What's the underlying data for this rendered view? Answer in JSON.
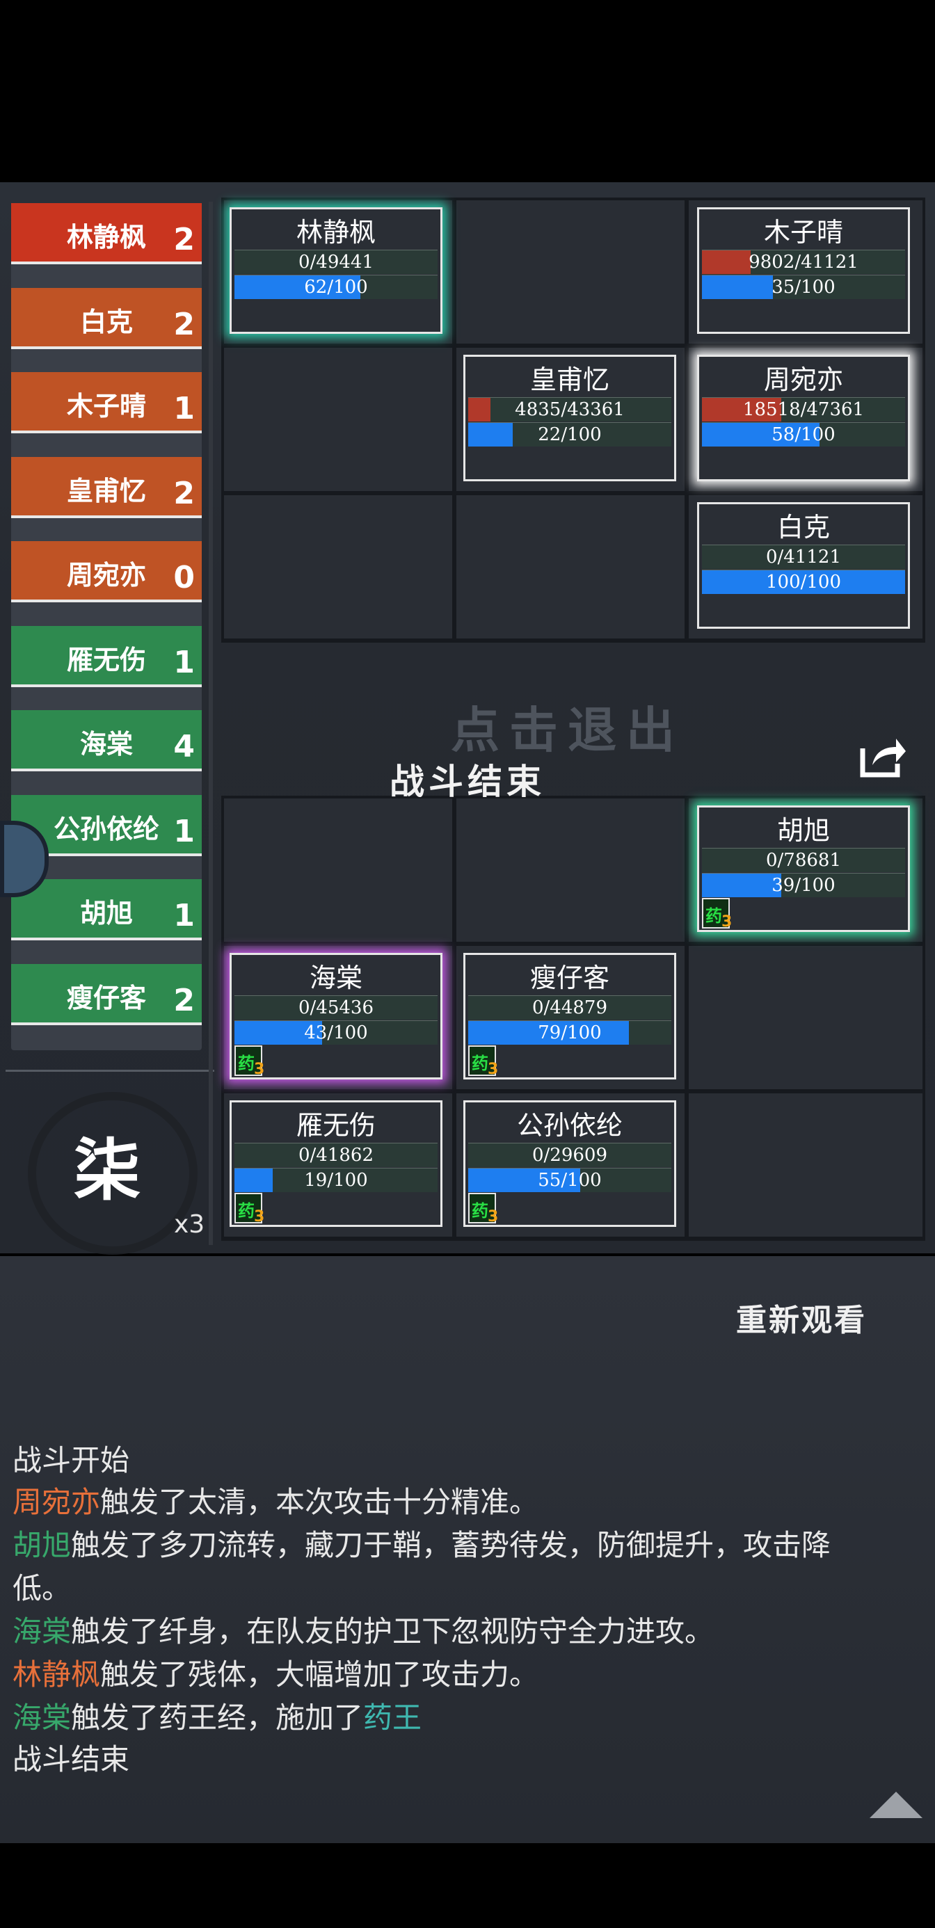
{
  "roster": [
    {
      "name": "林静枫",
      "count": "2",
      "color": "red"
    },
    {
      "name": "白克",
      "count": "2",
      "color": "org"
    },
    {
      "name": "木子晴",
      "count": "1",
      "color": "org"
    },
    {
      "name": "皇甫忆",
      "count": "2",
      "color": "org"
    },
    {
      "name": "周宛亦",
      "count": "0",
      "color": "org"
    },
    {
      "name": "雁无伤",
      "count": "1",
      "color": "grn"
    },
    {
      "name": "海棠",
      "count": "4",
      "color": "grn"
    },
    {
      "name": "公孙依纶",
      "count": "1",
      "color": "grn"
    },
    {
      "name": "胡旭",
      "count": "1",
      "color": "grn"
    },
    {
      "name": "瘦仔客",
      "count": "2",
      "color": "grn"
    }
  ],
  "enemy_cards": [
    {
      "name": "林静枫",
      "hp": "0/49441",
      "hp_fraction": 0,
      "mp": "62/100",
      "mp_fraction": 0.62,
      "glow": "glow-teal"
    },
    {
      "name": "木子晴",
      "hp": "9802/41121",
      "hp_fraction": 0.24,
      "mp": "35/100",
      "mp_fraction": 0.35,
      "glow": ""
    },
    {
      "name": "皇甫忆",
      "hp": "4835/43361",
      "hp_fraction": 0.11,
      "mp": "22/100",
      "mp_fraction": 0.22,
      "glow": ""
    },
    {
      "name": "周宛亦",
      "hp": "18518/47361",
      "hp_fraction": 0.39,
      "mp": "58/100",
      "mp_fraction": 0.58,
      "glow": "glow-white"
    },
    {
      "name": "白克",
      "hp": "0/41121",
      "hp_fraction": 0,
      "mp": "100/100",
      "mp_fraction": 1.0,
      "glow": ""
    }
  ],
  "ally_cards": [
    {
      "name": "胡旭",
      "hp": "0/78681",
      "hp_fraction": 0,
      "mp": "39/100",
      "mp_fraction": 0.39,
      "glow": "glow-green",
      "med": "药",
      "med_count": "3"
    },
    {
      "name": "海棠",
      "hp": "0/45436",
      "hp_fraction": 0,
      "mp": "43/100",
      "mp_fraction": 0.43,
      "glow": "glow-purple",
      "med": "药",
      "med_count": "3"
    },
    {
      "name": "瘦仔客",
      "hp": "0/44879",
      "hp_fraction": 0,
      "mp": "79/100",
      "mp_fraction": 0.79,
      "glow": "",
      "med": "药",
      "med_count": "3"
    },
    {
      "name": "雁无伤",
      "hp": "0/41862",
      "hp_fraction": 0,
      "mp": "19/100",
      "mp_fraction": 0.19,
      "glow": "",
      "med": "药",
      "med_count": "3"
    },
    {
      "name": "公孙依纶",
      "hp": "0/29609",
      "hp_fraction": 0,
      "mp": "55/100",
      "mp_fraction": 0.55,
      "glow": "",
      "med": "药",
      "med_count": "3"
    }
  ],
  "center": {
    "click_exit": "点击退出",
    "battle_end": "战斗结束"
  },
  "round": {
    "char": "柒",
    "multiplier": "x3"
  },
  "replay": "重新观看",
  "log": {
    "l1": "战斗开始",
    "l2_name": "周宛亦",
    "l2_text": "触发了太清，本次攻击十分精准。",
    "l3_name": "胡旭",
    "l3_text": "触发了多刀流转，藏刀于鞘，蓄势待发，防御提升，攻击降",
    "l3_cont": "低。",
    "l4_name": "海棠",
    "l4_text": "触发了纤身，在队友的护卫下忽视防守全力进攻。",
    "l5_name": "林静枫",
    "l5_text": "触发了残体，大幅增加了攻击力。",
    "l6_name": "海棠",
    "l6_text": "触发了药王经，施加了",
    "l6_effect": "药王",
    "l7": "战斗结束"
  }
}
